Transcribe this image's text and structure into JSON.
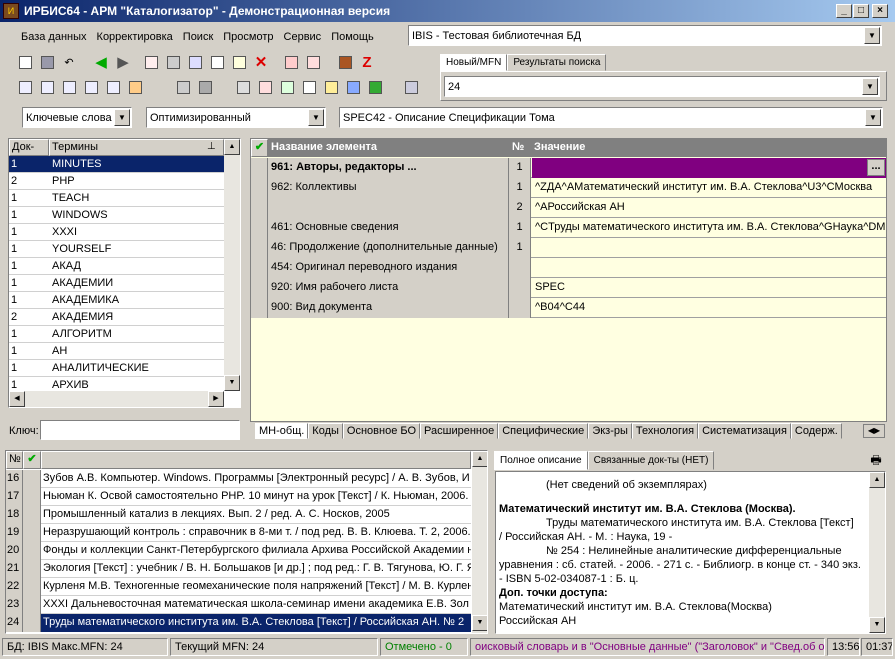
{
  "window": {
    "title": "ИРБИС64 - АРМ \"Каталогизатор\" - Демонстрационная версия",
    "min": "_",
    "max": "□",
    "close": "×"
  },
  "menu": [
    "База данных",
    "Корректировка",
    "Поиск",
    "Просмотр",
    "Сервис",
    "Помощь"
  ],
  "db_combo": "IBIS - Тестовая библиотечная БД",
  "mfn_tabs": [
    "Новый/MFN",
    "Результаты поиска"
  ],
  "mfn_value": "24",
  "search_row": {
    "mode": "Ключевые слова",
    "optimization": "Оптимизированный",
    "worksheet": "SPEC42 - Описание Спецификации Тома"
  },
  "dictionary": {
    "col_docs": "Док-ов",
    "col_terms": "Термины",
    "key_label": "Ключ:",
    "rows": [
      [
        "1",
        "MINUTES"
      ],
      [
        "2",
        "PHP"
      ],
      [
        "1",
        "TEACH"
      ],
      [
        "1",
        "WINDOWS"
      ],
      [
        "1",
        "XXXI"
      ],
      [
        "1",
        "YOURSELF"
      ],
      [
        "1",
        "АКАД"
      ],
      [
        "1",
        "АКАДЕМИИ"
      ],
      [
        "1",
        "АКАДЕМИКА"
      ],
      [
        "2",
        "АКАДЕМИЯ"
      ],
      [
        "1",
        "АЛГОРИТМ"
      ],
      [
        "1",
        "АН"
      ],
      [
        "1",
        "АНАЛИТИЧЕСКИЕ"
      ],
      [
        "1",
        "АРХИВ"
      ]
    ]
  },
  "editor": {
    "col_name": "Название элемента",
    "col_num": "№",
    "col_value": "Значение",
    "ellipsis": "...",
    "rows": [
      {
        "name": "961: Авторы, редакторы ...",
        "num": "1",
        "value": ""
      },
      {
        "name": "962: Коллективы",
        "num": "1",
        "value": "^ZДА^AМатематический институт им. В.А. Стеклова^U3^CМосква"
      },
      {
        "name": "",
        "num": "2",
        "value": "^AРоссийская АН"
      },
      {
        "name": "461: Основные сведения",
        "num": "1",
        "value": "^CТруды математического института им. В.А. Стеклова^GНаука^DМ"
      },
      {
        "name": "46: Продолжение (дополнительные данные)",
        "num": "1",
        "value": ""
      },
      {
        "name": "454: Оригинал переводного издания",
        "num": "",
        "value": ""
      },
      {
        "name": "920: Имя рабочего листа",
        "num": "",
        "value": "SPEC"
      },
      {
        "name": "900: Вид документа",
        "num": "",
        "value": "^B04^C44"
      }
    ],
    "tabs": [
      "МН-общ.",
      "Коды",
      "Основное БО",
      "Расширенное",
      "Специфические",
      "Экз-ры",
      "Технология",
      "Систематизация",
      "Содерж."
    ]
  },
  "results": {
    "col_num": "№",
    "rows": [
      [
        "16",
        "Зубов А.В. Компьютер. Windows. Программы [Электронный ресурс] / А. В. Зубов, И"
      ],
      [
        "17",
        "Ньюман К. Освой самостоятельно PHP. 10 минут на урок [Текст] / К. Ньюман, 2006."
      ],
      [
        "18",
        "Промышленный катализ в лекциях. Вып. 2 / ред. А. С. Носков, 2005"
      ],
      [
        "19",
        "Неразрушающий контроль : справочник в 8-ми т. / под ред. В. В. Клюева. Т. 2, 2006."
      ],
      [
        "20",
        "Фонды и коллекции Санкт-Петербургского филиала Архива Российской Академии н"
      ],
      [
        "21",
        "Экология [Текст] : учебник / В. Н. Большаков [и др.] ; под ред.: Г. В. Тягунова, Ю. Г. Я"
      ],
      [
        "22",
        "Курленя М.В. Техногенные геомеханические поля напряжений [Текст] / М. В. Курлен"
      ],
      [
        "23",
        "XXXI Дальневосточная математическая школа-семинар имени академика Е.В. Зол"
      ],
      [
        "24",
        "Труды математического института им. В.А. Стеклова [Текст] / Российская АН. № 2"
      ]
    ]
  },
  "desc": {
    "tabs": [
      "Полное описание",
      "Связанные док-ты (НЕТ)"
    ],
    "lines": [
      "(Нет сведений об экземплярах)",
      "Математический институт им. В.А. Стеклова (Москва).",
      "Труды математического института им. В.А. Стеклова [Текст]",
      "/ Российская АН. - М. : Наука, 19 -",
      "№ 254 : Нелинейные аналитические дифференциальные",
      "уравнения : сб. статей. - 2006. - 271 с. - Библиогр. в конце ст. - 340 экз.",
      "- ISBN 5-02-034087-1 : Б. ц.",
      "Доп. точки доступа:",
      "Математический институт им. В.А. Стеклова(Москва)",
      "Российская АН"
    ]
  },
  "status": {
    "db": "БД: IBIS Макс.MFN: 24",
    "current": "Текущий MFN: 24",
    "marked": "Отмечено - 0",
    "hint": "оисковый словарь и в \"Основные данные\" (\"Заголовок\" и \"Свед.об о",
    "t1": "13:56",
    "t2": "01:37"
  },
  "colors": {
    "selected": "#0a246a",
    "edit_row": "#800080",
    "value_bg": "#ffffe1",
    "marked": "#008000",
    "hint": "#800080"
  }
}
